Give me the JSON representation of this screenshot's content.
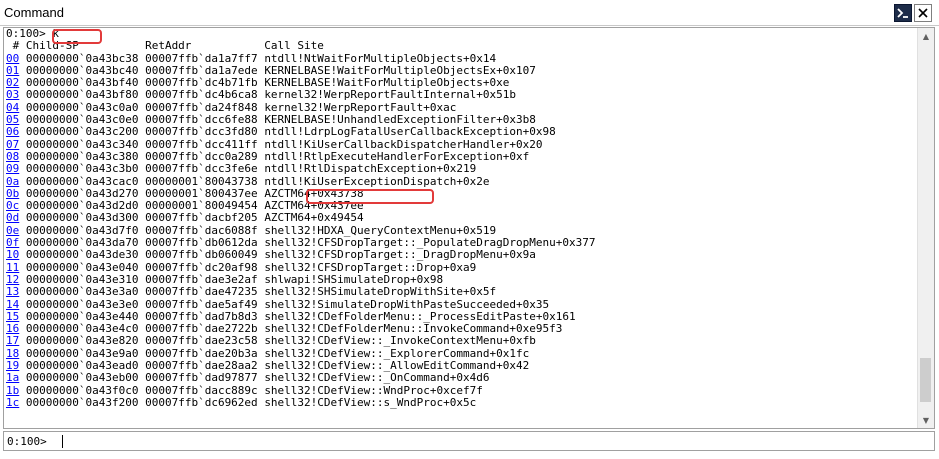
{
  "window": {
    "title": "Command"
  },
  "output": {
    "prompt_line": "0:100> k",
    "header": " # Child-SP          RetAddr           Call Site",
    "frames": [
      {
        "num": "00",
        "sp": "00000000`0a43bc38",
        "ret": "00007ffb`da1a7ff7",
        "site": "ntdll!NtWaitForMultipleObjects+0x14"
      },
      {
        "num": "01",
        "sp": "00000000`0a43bc40",
        "ret": "00007ffb`da1a7ede",
        "site": "KERNELBASE!WaitForMultipleObjectsEx+0x107"
      },
      {
        "num": "02",
        "sp": "00000000`0a43bf40",
        "ret": "00007ffb`dc4b71fb",
        "site": "KERNELBASE!WaitForMultipleObjects+0xe"
      },
      {
        "num": "03",
        "sp": "00000000`0a43bf80",
        "ret": "00007ffb`dc4b6ca8",
        "site": "kernel32!WerpReportFaultInternal+0x51b"
      },
      {
        "num": "04",
        "sp": "00000000`0a43c0a0",
        "ret": "00007ffb`da24f848",
        "site": "kernel32!WerpReportFault+0xac"
      },
      {
        "num": "05",
        "sp": "00000000`0a43c0e0",
        "ret": "00007ffb`dcc6fe88",
        "site": "KERNELBASE!UnhandledExceptionFilter+0x3b8"
      },
      {
        "num": "06",
        "sp": "00000000`0a43c200",
        "ret": "00007ffb`dcc3fd80",
        "site": "ntdll!LdrpLogFatalUserCallbackException+0x98"
      },
      {
        "num": "07",
        "sp": "00000000`0a43c340",
        "ret": "00007ffb`dcc411ff",
        "site": "ntdll!KiUserCallbackDispatcherHandler+0x20"
      },
      {
        "num": "08",
        "sp": "00000000`0a43c380",
        "ret": "00007ffb`dcc0a289",
        "site": "ntdll!RtlpExecuteHandlerForException+0xf"
      },
      {
        "num": "09",
        "sp": "00000000`0a43c3b0",
        "ret": "00007ffb`dcc3fe6e",
        "site": "ntdll!RtlDispatchException+0x219"
      },
      {
        "num": "0a",
        "sp": "00000000`0a43cac0",
        "ret": "00000001`80043738",
        "site": "ntdll!KiUserExceptionDispatch+0x2e"
      },
      {
        "num": "0b",
        "sp": "00000000`0a43d270",
        "ret": "00000001`800437ee",
        "site": "AZCTM64+0x43738"
      },
      {
        "num": "0c",
        "sp": "00000000`0a43d2d0",
        "ret": "00000001`80049454",
        "site": "AZCTM64+0x437ee"
      },
      {
        "num": "0d",
        "sp": "00000000`0a43d300",
        "ret": "00007ffb`dacbf205",
        "site": "AZCTM64+0x49454"
      },
      {
        "num": "0e",
        "sp": "00000000`0a43d7f0",
        "ret": "00007ffb`dac6088f",
        "site": "shell32!HDXA_QueryContextMenu+0x519"
      },
      {
        "num": "0f",
        "sp": "00000000`0a43da70",
        "ret": "00007ffb`db0612da",
        "site": "shell32!CFSDropTarget::_PopulateDragDropMenu+0x377"
      },
      {
        "num": "10",
        "sp": "00000000`0a43de30",
        "ret": "00007ffb`db060049",
        "site": "shell32!CFSDropTarget::_DragDropMenu+0x9a"
      },
      {
        "num": "11",
        "sp": "00000000`0a43e040",
        "ret": "00007ffb`dc20af98",
        "site": "shell32!CFSDropTarget::Drop+0xa9"
      },
      {
        "num": "12",
        "sp": "00000000`0a43e310",
        "ret": "00007ffb`dae3e2af",
        "site": "shlwapi!SHSimulateDrop+0x98"
      },
      {
        "num": "13",
        "sp": "00000000`0a43e3a0",
        "ret": "00007ffb`dae47235",
        "site": "shell32!SHSimulateDropWithSite+0x5f"
      },
      {
        "num": "14",
        "sp": "00000000`0a43e3e0",
        "ret": "00007ffb`dae5af49",
        "site": "shell32!SimulateDropWithPasteSucceeded+0x35"
      },
      {
        "num": "15",
        "sp": "00000000`0a43e440",
        "ret": "00007ffb`dad7b8d3",
        "site": "shell32!CDefFolderMenu::_ProcessEditPaste+0x161"
      },
      {
        "num": "16",
        "sp": "00000000`0a43e4c0",
        "ret": "00007ffb`dae2722b",
        "site": "shell32!CDefFolderMenu::InvokeCommand+0xe95f3"
      },
      {
        "num": "17",
        "sp": "00000000`0a43e820",
        "ret": "00007ffb`dae23c58",
        "site": "shell32!CDefView::_InvokeContextMenu+0xfb"
      },
      {
        "num": "18",
        "sp": "00000000`0a43e9a0",
        "ret": "00007ffb`dae20b3a",
        "site": "shell32!CDefView::_ExplorerCommand+0x1fc"
      },
      {
        "num": "19",
        "sp": "00000000`0a43ead0",
        "ret": "00007ffb`dae28aa2",
        "site": "shell32!CDefView::_AllowEditCommand+0x42"
      },
      {
        "num": "1a",
        "sp": "00000000`0a43eb00",
        "ret": "00007ffb`dad97877",
        "site": "shell32!CDefView::_OnCommand+0x4d6"
      },
      {
        "num": "1b",
        "sp": "00000000`0a43f0c0",
        "ret": "00007ffb`dacc889c",
        "site": "shell32!CDefView::WndProc+0xcef7f"
      },
      {
        "num": "1c",
        "sp": "00000000`0a43f200",
        "ret": "00007ffb`dc6962ed",
        "site": "shell32!CDefView::s_WndProc+0x5c"
      }
    ]
  },
  "input": {
    "prompt": "0:100>",
    "value": ""
  },
  "colors": {
    "link": "#0000ff",
    "highlight": "#e23a3a",
    "titlebar_button": "#1d2c49"
  },
  "icons": {
    "command": "command-prompt-icon",
    "close": "close-icon",
    "up": "scroll-up-icon",
    "down": "scroll-down-icon"
  }
}
